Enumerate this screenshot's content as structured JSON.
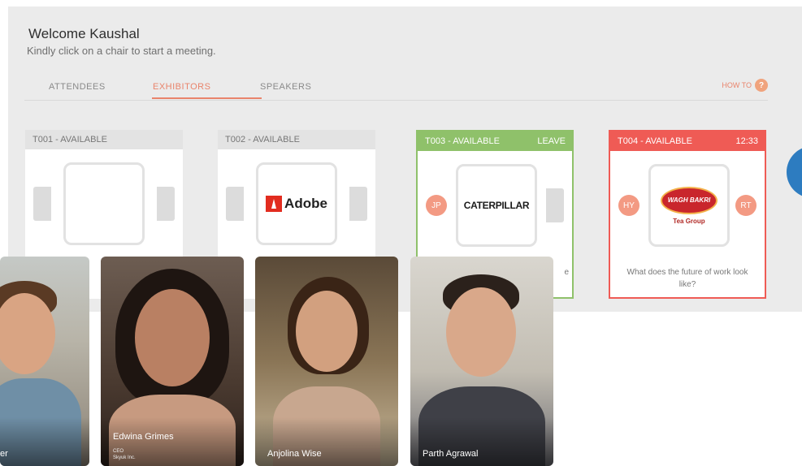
{
  "header": {
    "welcome": "Welcome Kaushal",
    "subtitle": "Kindly click on a chair to start a meeting."
  },
  "tabs": [
    {
      "label": "ATTENDEES",
      "active": false
    },
    {
      "label": "EXHIBITORS",
      "active": true
    },
    {
      "label": "SPEAKERS",
      "active": false
    }
  ],
  "how_to": {
    "label": "HOW TO",
    "icon": "question-icon",
    "glyph": "?"
  },
  "tables": [
    {
      "id": "T001 - AVAILABLE",
      "status": "available",
      "right": "",
      "logo": "",
      "seats": [],
      "topic": ""
    },
    {
      "id": "T002 - AVAILABLE",
      "status": "available",
      "right": "",
      "logo": "Adobe",
      "seats": [],
      "topic": ""
    },
    {
      "id": "T003 - AVAILABLE",
      "status": "joined",
      "right": "LEAVE",
      "logo": "CATERPILLAR",
      "seats": [
        "JP"
      ],
      "topic": "e"
    },
    {
      "id": "T004 - AVAILABLE",
      "status": "busy",
      "right": "12:33",
      "logo": "WAGH BAKRI",
      "logo_sub": "Tea Group",
      "seats": [
        "HY",
        "RT"
      ],
      "topic": "What does the future of work look like?"
    }
  ],
  "videos": [
    {
      "name": "er",
      "title": "",
      "company": ""
    },
    {
      "name": "Edwina Grimes",
      "title": "CEO",
      "company": "Skyuk Inc."
    },
    {
      "name": "Anjolina Wise",
      "title": "",
      "company": ""
    },
    {
      "name": "Parth Agrawal",
      "title": "",
      "company": ""
    }
  ],
  "colors": {
    "accent": "#e9846c",
    "available_green": "#8fc16a",
    "busy_red": "#ef5b55",
    "panel_bg": "#ebebeb"
  }
}
